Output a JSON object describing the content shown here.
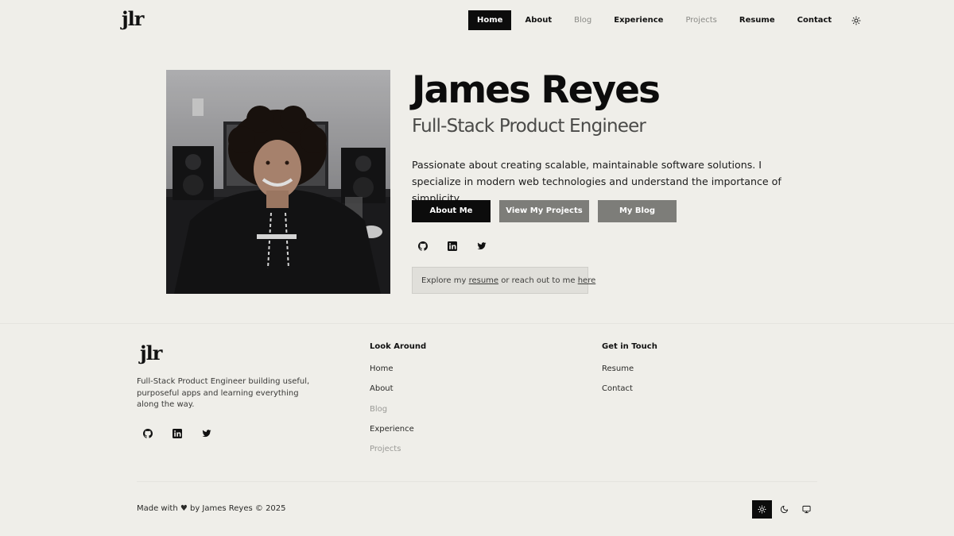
{
  "header": {
    "logo": "jlr",
    "nav": [
      {
        "label": "Home",
        "state": "active"
      },
      {
        "label": "About",
        "state": "normal"
      },
      {
        "label": "Blog",
        "state": "muted"
      },
      {
        "label": "Experience",
        "state": "normal"
      },
      {
        "label": "Projects",
        "state": "muted"
      },
      {
        "label": "Resume",
        "state": "normal"
      },
      {
        "label": "Contact",
        "state": "normal"
      }
    ],
    "theme_icon": "sun-icon"
  },
  "hero": {
    "name": "James Reyes",
    "title": "Full-Stack Product Engineer",
    "intro": "Passionate about creating scalable, maintainable software solutions. I specialize in modern web technologies and understand the importance of simplicity.",
    "buttons": {
      "about": "About Me",
      "projects": "View My Projects",
      "blog": "My Blog"
    },
    "social_icons": [
      "github-icon",
      "linkedin-icon",
      "twitter-icon"
    ],
    "callout": {
      "prefix": "Explore my",
      "link1": "resume",
      "middle": "or reach out to me",
      "link2": "here"
    }
  },
  "footer": {
    "logo": "jlr",
    "description": "Full-Stack Product Engineer building useful, purposeful apps and learning everything along the way.",
    "look_around": {
      "title": "Look Around",
      "items": [
        "Home",
        "About",
        "Blog",
        "Experience",
        "Projects"
      ]
    },
    "get_in_touch": {
      "title": "Get in Touch",
      "items": [
        "Resume",
        "Contact"
      ]
    },
    "copyright": "Made with ♥ by James Reyes © 2025",
    "theme_options": [
      "sun-icon",
      "moon-icon",
      "monitor-icon"
    ]
  },
  "colors": {
    "background": "#efeee9",
    "primary": "#0c0c0c",
    "secondary_button": "#7d7d79",
    "muted_text": "#8a8a86"
  }
}
